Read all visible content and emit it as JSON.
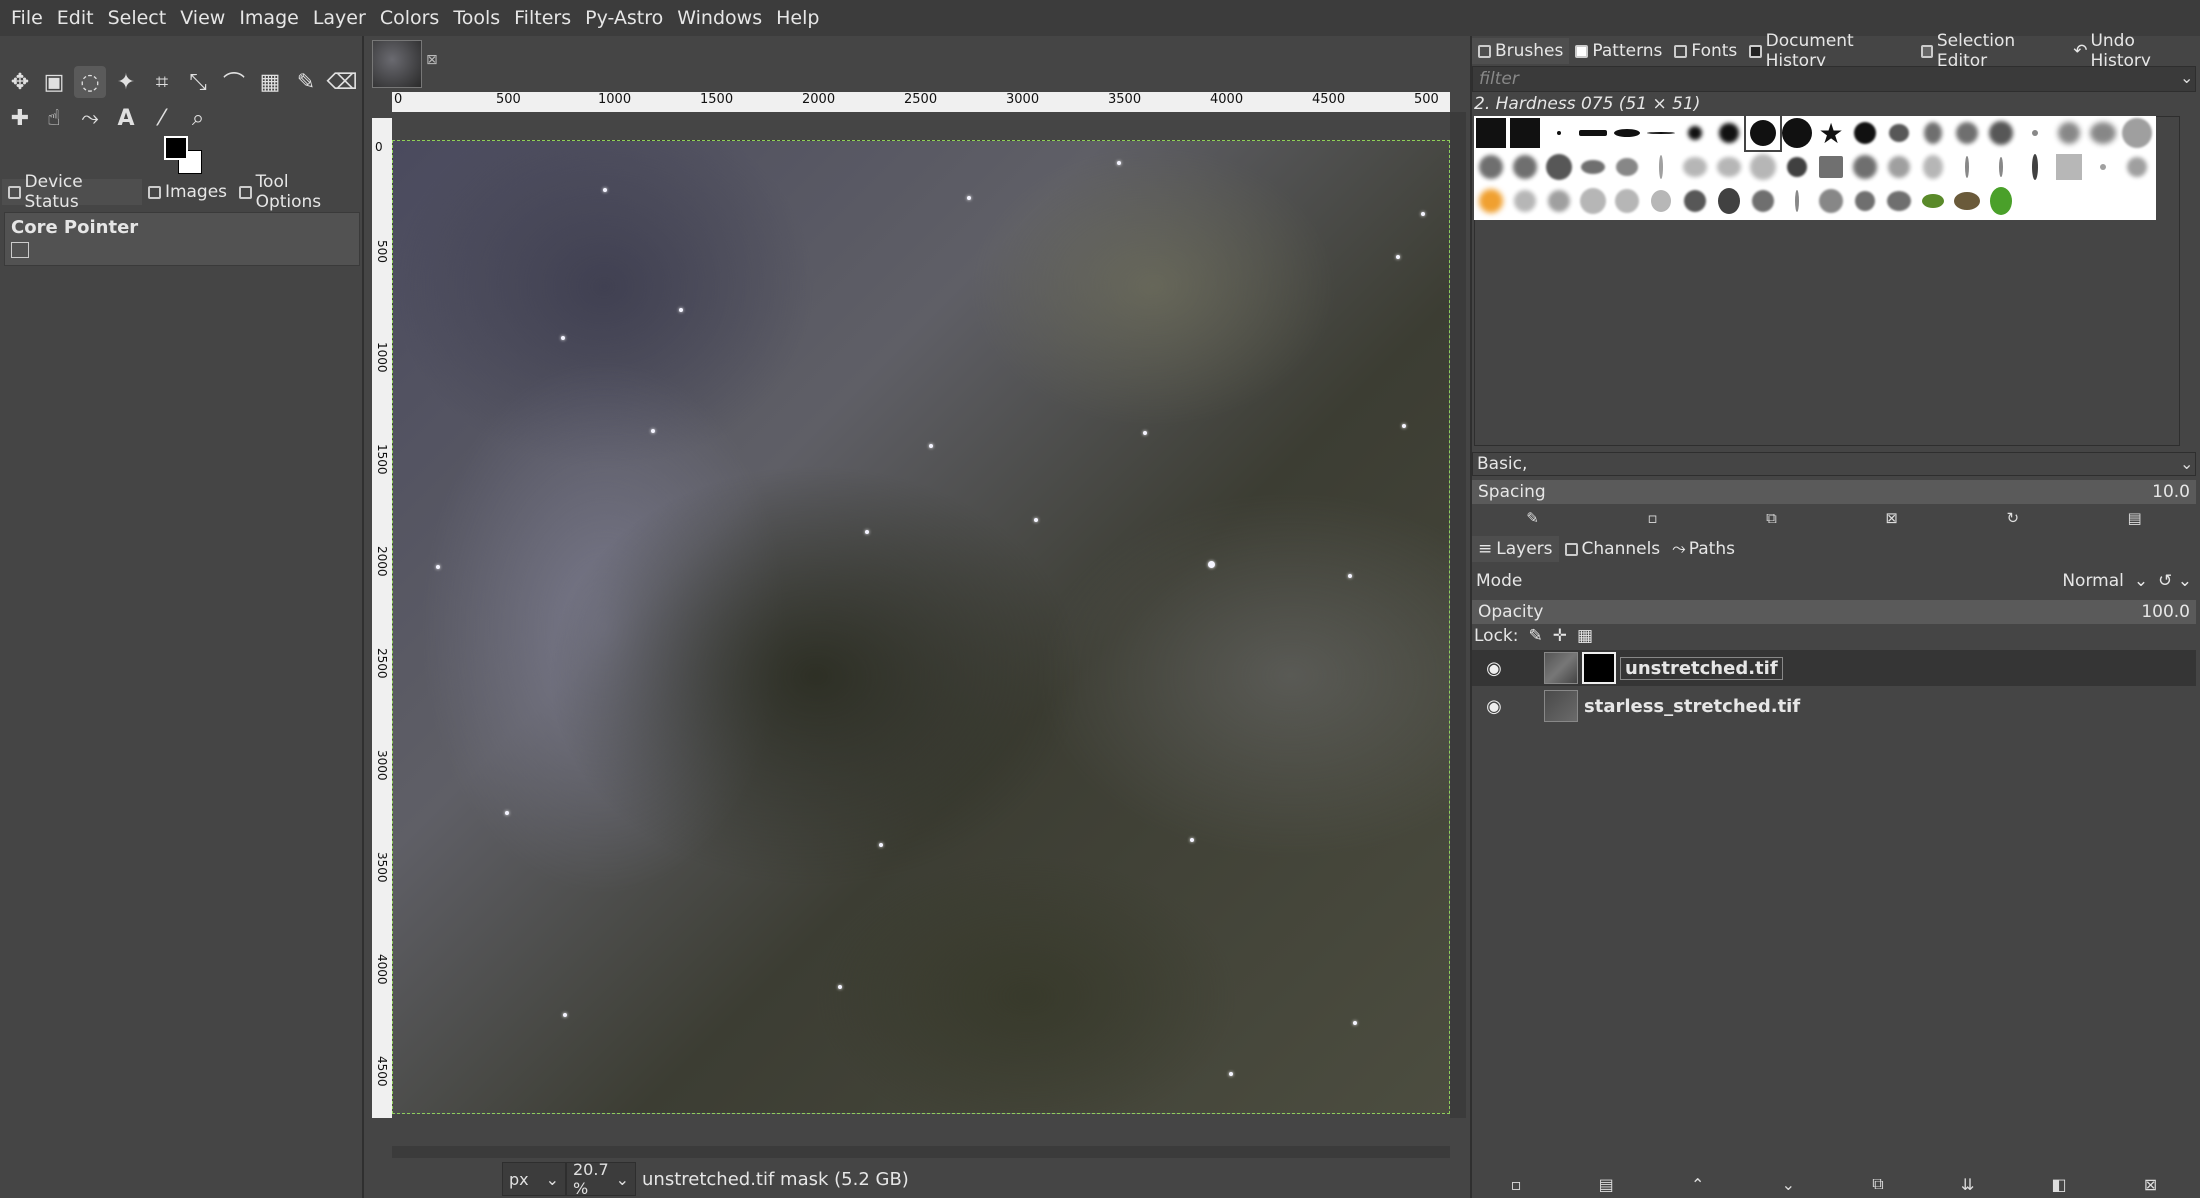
{
  "menu": [
    "File",
    "Edit",
    "Select",
    "View",
    "Image",
    "Layer",
    "Colors",
    "Tools",
    "Filters",
    "Py-Astro",
    "Windows",
    "Help"
  ],
  "left_dock": {
    "tabs": [
      "Device Status",
      "Images",
      "Tool Options"
    ],
    "device": "Core Pointer"
  },
  "ruler": {
    "h_labels": [
      "0",
      "500",
      "1000",
      "1500",
      "2000",
      "2500",
      "3000",
      "3500",
      "4000",
      "4500",
      "500"
    ],
    "v_labels": [
      "0",
      "500",
      "1000",
      "1500",
      "2000",
      "2500",
      "3000",
      "3500",
      "4000",
      "4500"
    ]
  },
  "status": {
    "unit": "px",
    "zoom": "20.7 %",
    "text": "unstretched.tif mask (5.2 GB)"
  },
  "brushes": {
    "tabs": [
      "Brushes",
      "Patterns",
      "Fonts",
      "Document History",
      "Selection Editor",
      "Undo History"
    ],
    "filter_placeholder": "filter",
    "selected_brush": "2. Hardness 075 (51 × 51)",
    "tag": "Basic,",
    "spacing_label": "Spacing",
    "spacing_value": "10.0"
  },
  "layers": {
    "tabs": [
      "Layers",
      "Channels",
      "Paths"
    ],
    "mode_label": "Mode",
    "mode_value": "Normal",
    "opacity_label": "Opacity",
    "opacity_value": "100.0",
    "lock_label": "Lock:",
    "items": [
      {
        "name": "unstretched.tif",
        "selected": true,
        "has_mask": true
      },
      {
        "name": "starless_stretched.tif",
        "selected": false,
        "has_mask": false
      }
    ]
  }
}
